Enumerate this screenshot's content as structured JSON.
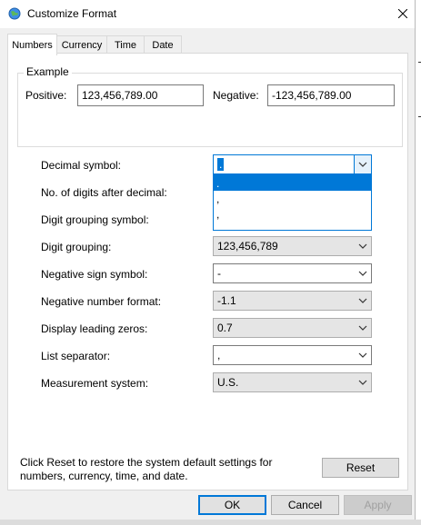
{
  "window": {
    "title": "Customize Format",
    "icon": "globe-settings-icon",
    "close_icon": "close-icon"
  },
  "tabs": [
    {
      "label": "Numbers",
      "active": true
    },
    {
      "label": "Currency",
      "active": false
    },
    {
      "label": "Time",
      "active": false
    },
    {
      "label": "Date",
      "active": false
    }
  ],
  "example": {
    "group_label": "Example",
    "positive_label": "Positive:",
    "positive_value": "123,456,789.00",
    "negative_label": "Negative:",
    "negative_value": "-123,456,789.00"
  },
  "settings": [
    {
      "key": "decimal",
      "label": "Decimal symbol:",
      "value": ".",
      "editable": true
    },
    {
      "key": "digits",
      "label": "No. of digits after decimal:",
      "value": "",
      "editable": false
    },
    {
      "key": "grouping_symbol",
      "label": "Digit grouping symbol:",
      "value": "",
      "editable": true
    },
    {
      "key": "grouping",
      "label": "Digit grouping:",
      "value": "123,456,789",
      "editable": false
    },
    {
      "key": "neg_sign",
      "label": "Negative sign symbol:",
      "value": "-",
      "editable": true
    },
    {
      "key": "neg_format",
      "label": "Negative number format:",
      "value": "-1.1",
      "editable": false
    },
    {
      "key": "leading_zeros",
      "label": "Display leading zeros:",
      "value": "0.7",
      "editable": false
    },
    {
      "key": "list_sep",
      "label": "List separator:",
      "value": ",",
      "editable": true
    },
    {
      "key": "measurement",
      "label": "Measurement system:",
      "value": "U.S.",
      "editable": false
    }
  ],
  "dropdown": {
    "options": [
      ".",
      ",",
      ","
    ],
    "highlighted_index": 0
  },
  "note": "Click Reset to restore the system default settings for numbers, currency, time, and date.",
  "buttons": {
    "reset": "Reset",
    "ok": "OK",
    "cancel": "Cancel",
    "apply": "Apply"
  },
  "colors": {
    "accent": "#0078d7",
    "dialog_bg": "#f0f0f0",
    "panel_bg": "#ffffff"
  }
}
